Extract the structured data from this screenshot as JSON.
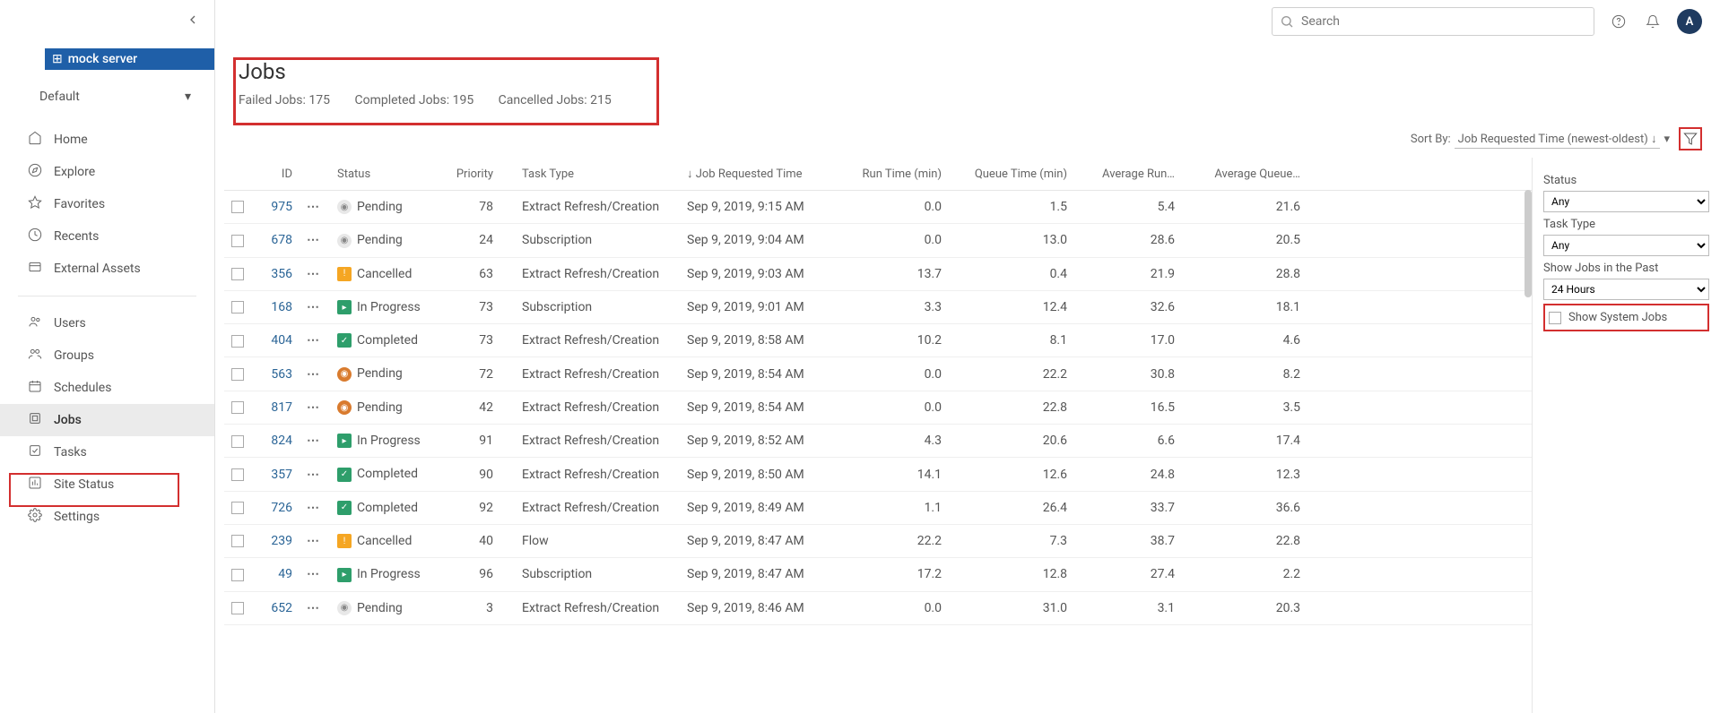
{
  "logo": {
    "text": "mock server"
  },
  "site_select": {
    "label": "Default"
  },
  "sidebar": {
    "sections": [
      [
        {
          "icon": "home",
          "label": "Home"
        },
        {
          "icon": "compass",
          "label": "Explore"
        },
        {
          "icon": "star",
          "label": "Favorites"
        },
        {
          "icon": "clock",
          "label": "Recents"
        },
        {
          "icon": "box",
          "label": "External Assets"
        }
      ],
      [
        {
          "icon": "users",
          "label": "Users"
        },
        {
          "icon": "group",
          "label": "Groups"
        },
        {
          "icon": "calendar",
          "label": "Schedules"
        },
        {
          "icon": "jobs",
          "label": "Jobs",
          "active": true
        },
        {
          "icon": "tasks",
          "label": "Tasks"
        },
        {
          "icon": "chart",
          "label": "Site Status"
        },
        {
          "icon": "gear",
          "label": "Settings"
        }
      ]
    ]
  },
  "search": {
    "placeholder": "Search"
  },
  "avatar": {
    "initial": "A"
  },
  "page": {
    "title": "Jobs",
    "stats": {
      "failed": "Failed Jobs: 175",
      "completed": "Completed Jobs: 195",
      "cancelled": "Cancelled Jobs: 215"
    }
  },
  "sort": {
    "label": "Sort By:",
    "value": "Job Requested Time (newest-oldest) ↓"
  },
  "columns": {
    "id": "ID",
    "status": "Status",
    "priority": "Priority",
    "task": "Task Type",
    "requested": "↓ Job Requested Time",
    "run": "Run Time (min)",
    "queue": "Queue Time (min)",
    "avgrun": "Average Run…",
    "avgqueue": "Average Queue…"
  },
  "rows": [
    {
      "id": "975",
      "status": "Pending",
      "badge": "pending",
      "priority": "78",
      "task": "Extract Refresh/Creation",
      "requested": "Sep 9, 2019, 9:15 AM",
      "run": "0.0",
      "queue": "1.5",
      "avgrun": "5.4",
      "avgqueue": "21.6"
    },
    {
      "id": "678",
      "status": "Pending",
      "badge": "pending",
      "priority": "24",
      "task": "Subscription",
      "requested": "Sep 9, 2019, 9:04 AM",
      "run": "0.0",
      "queue": "13.0",
      "avgrun": "28.6",
      "avgqueue": "20.5"
    },
    {
      "id": "356",
      "status": "Cancelled",
      "badge": "cancelled",
      "priority": "63",
      "task": "Extract Refresh/Creation",
      "requested": "Sep 9, 2019, 9:03 AM",
      "run": "13.7",
      "queue": "0.4",
      "avgrun": "21.9",
      "avgqueue": "28.8"
    },
    {
      "id": "168",
      "status": "In Progress",
      "badge": "inprogress",
      "priority": "73",
      "task": "Subscription",
      "requested": "Sep 9, 2019, 9:01 AM",
      "run": "3.3",
      "queue": "12.4",
      "avgrun": "32.6",
      "avgqueue": "18.1"
    },
    {
      "id": "404",
      "status": "Completed",
      "badge": "completed",
      "priority": "73",
      "task": "Extract Refresh/Creation",
      "requested": "Sep 9, 2019, 8:58 AM",
      "run": "10.2",
      "queue": "8.1",
      "avgrun": "17.0",
      "avgqueue": "4.6"
    },
    {
      "id": "563",
      "status": "Pending",
      "badge": "pending-orange",
      "priority": "72",
      "task": "Extract Refresh/Creation",
      "requested": "Sep 9, 2019, 8:54 AM",
      "run": "0.0",
      "queue": "22.2",
      "avgrun": "30.8",
      "avgqueue": "8.2"
    },
    {
      "id": "817",
      "status": "Pending",
      "badge": "pending-orange",
      "priority": "42",
      "task": "Extract Refresh/Creation",
      "requested": "Sep 9, 2019, 8:54 AM",
      "run": "0.0",
      "queue": "22.8",
      "avgrun": "16.5",
      "avgqueue": "3.5"
    },
    {
      "id": "824",
      "status": "In Progress",
      "badge": "inprogress",
      "priority": "91",
      "task": "Extract Refresh/Creation",
      "requested": "Sep 9, 2019, 8:52 AM",
      "run": "4.3",
      "queue": "20.6",
      "avgrun": "6.6",
      "avgqueue": "17.4"
    },
    {
      "id": "357",
      "status": "Completed",
      "badge": "completed",
      "priority": "90",
      "task": "Extract Refresh/Creation",
      "requested": "Sep 9, 2019, 8:50 AM",
      "run": "14.1",
      "queue": "12.6",
      "avgrun": "24.8",
      "avgqueue": "12.3"
    },
    {
      "id": "726",
      "status": "Completed",
      "badge": "completed",
      "priority": "92",
      "task": "Extract Refresh/Creation",
      "requested": "Sep 9, 2019, 8:49 AM",
      "run": "1.1",
      "queue": "26.4",
      "avgrun": "33.7",
      "avgqueue": "36.6"
    },
    {
      "id": "239",
      "status": "Cancelled",
      "badge": "cancelled",
      "priority": "40",
      "task": "Flow",
      "requested": "Sep 9, 2019, 8:47 AM",
      "run": "22.2",
      "queue": "7.3",
      "avgrun": "38.7",
      "avgqueue": "22.8"
    },
    {
      "id": "49",
      "status": "In Progress",
      "badge": "inprogress",
      "priority": "96",
      "task": "Subscription",
      "requested": "Sep 9, 2019, 8:47 AM",
      "run": "17.2",
      "queue": "12.8",
      "avgrun": "27.4",
      "avgqueue": "2.2"
    },
    {
      "id": "652",
      "status": "Pending",
      "badge": "pending",
      "priority": "3",
      "task": "Extract Refresh/Creation",
      "requested": "Sep 9, 2019, 8:46 AM",
      "run": "0.0",
      "queue": "31.0",
      "avgrun": "3.1",
      "avgqueue": "20.3"
    }
  ],
  "filters": {
    "status": {
      "label": "Status",
      "value": "Any"
    },
    "task": {
      "label": "Task Type",
      "value": "Any"
    },
    "past": {
      "label": "Show Jobs in the Past",
      "value": "24 Hours"
    },
    "system": {
      "label": "Show System Jobs"
    }
  }
}
